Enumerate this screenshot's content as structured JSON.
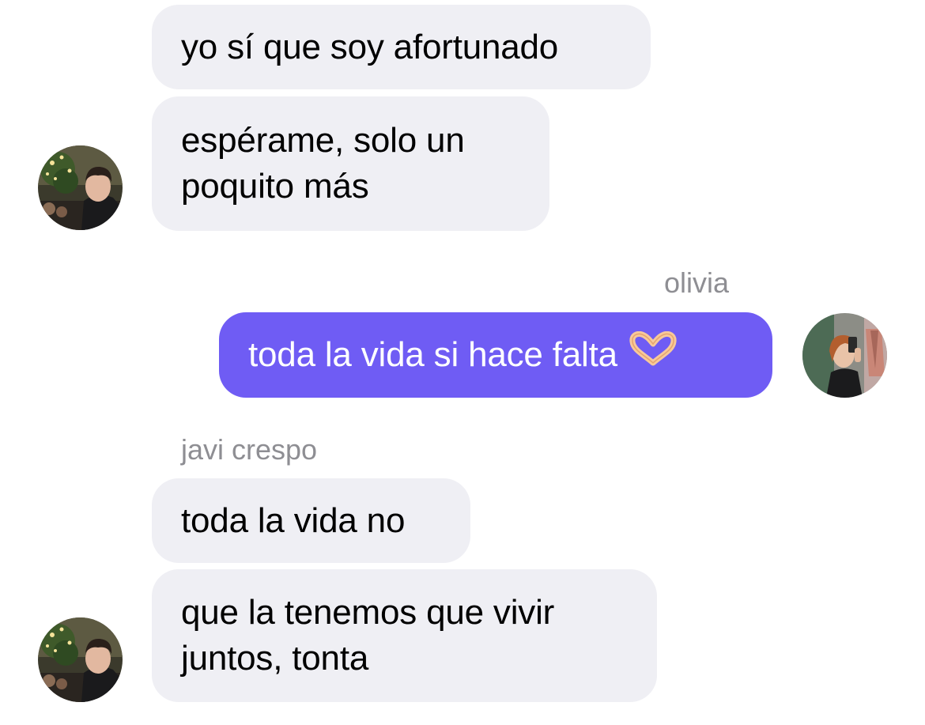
{
  "messages": [
    {
      "from": "javi crespo",
      "lines": [
        "yo sí que soy afortunado"
      ]
    },
    {
      "from": "javi crespo",
      "lines": [
        "espérame, solo un",
        "poquito más"
      ]
    },
    {
      "from": "olivia",
      "lines": [
        "toda la vida si hace falta"
      ],
      "emoji": "heart-hands-icon"
    },
    {
      "from": "javi crespo",
      "lines": [
        "toda la vida no"
      ]
    },
    {
      "from": "javi crespo",
      "lines": [
        "que la tenemos que vivir",
        "juntos, tonta"
      ]
    }
  ],
  "senders": {
    "outgoing_name": "olivia",
    "incoming_name": "javi crespo"
  },
  "colors": {
    "incoming_bubble": "#efeff4",
    "outgoing_bubble": "#6f5cf4",
    "sender_label": "#8e8e93"
  }
}
